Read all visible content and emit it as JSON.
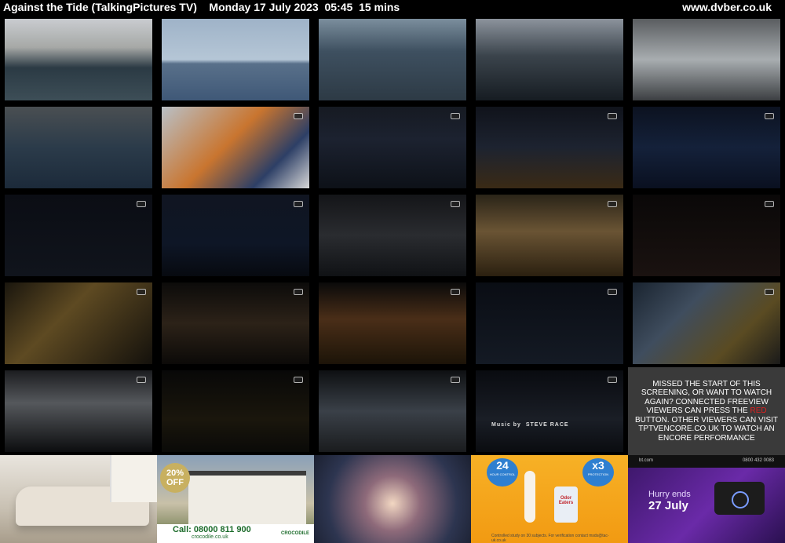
{
  "header": {
    "title": "Against the Tide (TalkingPictures TV)    Monday 17 July 2023  05:45  15 mins",
    "site": "www.dvber.co.uk"
  },
  "thumbnails": [
    {
      "row": 0,
      "col": 0,
      "bg": "linear-gradient(180deg,#c9ccd0 0%,#a6a8a6 35%,#2b3a44 60%,#3d4e57 100%)"
    },
    {
      "row": 0,
      "col": 1,
      "bg": "linear-gradient(180deg,#9fb3c8 0%,#b5c6d6 50%,#59708a 55%,#3f5877 100%)"
    },
    {
      "row": 0,
      "col": 2,
      "bg": "linear-gradient(180deg,#7b8e9d 0%,#3e5060 40%,#2d3a45 100%)"
    },
    {
      "row": 0,
      "col": 3,
      "bg": "linear-gradient(180deg,#8c939c 0%,#3b444c 45%,#161c22 100%)"
    },
    {
      "row": 0,
      "col": 4,
      "bg": "linear-gradient(180deg,#5a5d60 0%,#a8adb0 50%,#3c3f42 100%)"
    },
    {
      "row": 1,
      "col": 0,
      "bg": "linear-gradient(180deg,#4a4f52 0%,#2b3b4a 50%,#1c2a3a 100%)"
    },
    {
      "row": 1,
      "col": 1,
      "bg": "linear-gradient(135deg,#b9c0c6 0%,#c9752f 45%,#2d3f66 75%,#d8d8d8 100%)"
    },
    {
      "row": 1,
      "col": 2,
      "bg": "linear-gradient(180deg,#161a22 0%,#1c2230 40%,#0d1118 100%)"
    },
    {
      "row": 1,
      "col": 3,
      "bg": "linear-gradient(180deg,#10131b 0%,#1d2330 50%,#3a2a15 100%)"
    },
    {
      "row": 1,
      "col": 4,
      "bg": "linear-gradient(180deg,#0c1220 0%,#14213a 50%,#0a1020 100%)"
    },
    {
      "row": 2,
      "col": 0,
      "bg": "linear-gradient(180deg,#0b0d14 0%,#10141c 100%)"
    },
    {
      "row": 2,
      "col": 1,
      "bg": "linear-gradient(180deg,#101521 0%,#0e1626 60%,#070a10 100%)"
    },
    {
      "row": 2,
      "col": 2,
      "bg": "linear-gradient(180deg,#141518 0%,#2a2c30 50%,#101215 100%)"
    },
    {
      "row": 2,
      "col": 3,
      "bg": "linear-gradient(180deg,#2a2418 0%,#6a5434 45%,#2b2010 100%)"
    },
    {
      "row": 2,
      "col": 4,
      "bg": "linear-gradient(180deg,#0a0808 0%,#1a1210 100%)"
    },
    {
      "row": 3,
      "col": 0,
      "bg": "linear-gradient(135deg,#1a160e 0%,#5e4a22 40%,#14110c 100%)"
    },
    {
      "row": 3,
      "col": 1,
      "bg": "linear-gradient(180deg,#0c0b0a 0%,#2c2218 50%,#0c0a08 100%)"
    },
    {
      "row": 3,
      "col": 2,
      "bg": "linear-gradient(180deg,#0a0a0a 0%,#4a2e18 45%,#1c1408 100%)"
    },
    {
      "row": 3,
      "col": 3,
      "bg": "linear-gradient(180deg,#0a0d14 0%,#141a24 100%)"
    },
    {
      "row": 3,
      "col": 4,
      "bg": "linear-gradient(135deg,#1a2430 0%,#3f4d5e 35%,#5a4b22 70%,#1a1a1a 100%)"
    },
    {
      "row": 4,
      "col": 0,
      "bg": "linear-gradient(180deg,#1c1d20 0%,#55585c 40%,#0c0d0f 100%)"
    },
    {
      "row": 4,
      "col": 1,
      "bg": "linear-gradient(180deg,#080808 0%,#1a160c 60%,#0a0a08 100%)"
    },
    {
      "row": 4,
      "col": 2,
      "bg": "linear-gradient(180deg,#0e1012 0%,#3a4048 50%,#1a1c1e 100%)"
    },
    {
      "row": 4,
      "col": 3,
      "bg": "linear-gradient(180deg,#090b10 0%,#1a1e26 60%,#0a0c10 100%)"
    }
  ],
  "credit": "Music by  STEVE RACE",
  "promo": {
    "text": "Missed the start of this screening, or want to watch again? Connected Freeview viewers can press the red button. Other viewers can visit tptvencore.co.uk to watch an encore performance",
    "text_color": "#ffffff",
    "red_word_color": "#e02020",
    "background": "#3a3a3a"
  },
  "ads": {
    "ad1": {
      "bg": "linear-gradient(180deg,#e9e5de 0%,#c9c1b3 60%,#a89d8b 100%)"
    },
    "ad2": {
      "badge": "20% OFF",
      "phone": "Call: 08000 811 900",
      "url": "crocodile.co.uk",
      "brand": "CROCODILE",
      "bg": "linear-gradient(180deg,#8aa0b8 0%,#c8c0a8 55%,#5f6e3e 100%)"
    },
    "ad3": {
      "bg": "radial-gradient(circle at 50% 55%,#f2d7c2 0%,#8e6a7a 30%,#2d3550 70%,#1b2030 100%)"
    },
    "ad4": {
      "left_badge_number": "24",
      "left_badge_text": "HOUR CONTROL",
      "right_badge_number": "x3",
      "right_badge_text": "PROTECTION",
      "brand": "Odor Eaters",
      "footer": "Controlled study on 30 subjects. For verification contact msds@tac-uk.co.uk",
      "bg": "linear-gradient(180deg,#f7b126 0%,#f29a12 100%)"
    },
    "ad5": {
      "brand": "bt.com",
      "phone": "0800 432 0083",
      "headline1": "Hurry ends",
      "headline2": "27 July",
      "bg": "linear-gradient(135deg,#3a1666 0%,#6a2aa8 55%,#2a1050 100%)"
    }
  }
}
